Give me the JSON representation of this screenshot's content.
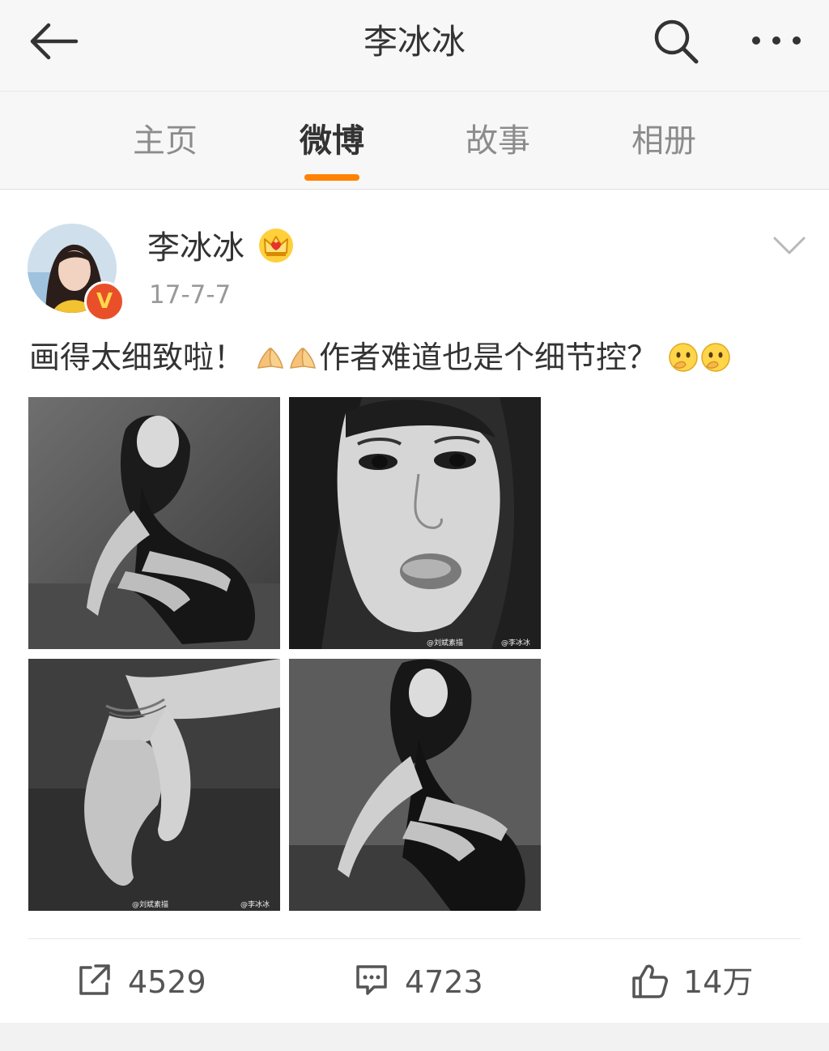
{
  "topbar": {
    "title": "李冰冰",
    "back_icon": "arrow-left-icon",
    "search_icon": "search-icon",
    "more_icon": "more-dots-icon"
  },
  "tabs": [
    {
      "label": "主页",
      "active": false
    },
    {
      "label": "微博",
      "active": true
    },
    {
      "label": "故事",
      "active": false
    },
    {
      "label": "相册",
      "active": false
    }
  ],
  "accent_color": "#ff8200",
  "post": {
    "username": "李冰冰",
    "time": "17-7-7",
    "verified_badge": "V",
    "text_part1": "画得太细致啦！",
    "text_part2": "作者难道也是个细节控？",
    "emoji_1": "hands-emoji",
    "emoji_2": "thinking-emoji",
    "images": [
      {
        "description_icon": "photo-woman-crouching"
      },
      {
        "description_icon": "photo-face-closeup",
        "watermark_left": "@刘斌素描",
        "watermark_right": "@李冰冰"
      },
      {
        "description_icon": "photo-hands-closeup",
        "watermark_left": "@刘斌素描",
        "watermark_right": "@李冰冰"
      },
      {
        "description_icon": "photo-woman-crouching-2"
      }
    ]
  },
  "actions": {
    "repost_count": "4529",
    "comment_count": "4723",
    "like_count": "14万"
  }
}
